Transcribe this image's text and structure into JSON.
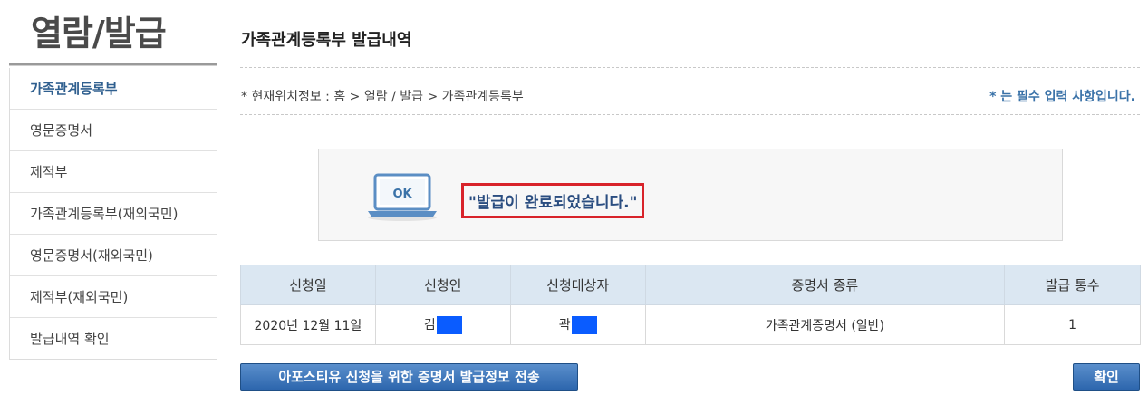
{
  "sidebar": {
    "title": "열람/발급",
    "items": [
      {
        "label": "가족관계등록부",
        "active": true
      },
      {
        "label": "영문증명서",
        "active": false
      },
      {
        "label": "제적부",
        "active": false
      },
      {
        "label": "가족관계등록부(재외국민)",
        "active": false
      },
      {
        "label": "영문증명서(재외국민)",
        "active": false
      },
      {
        "label": "제적부(재외국민)",
        "active": false
      },
      {
        "label": "발급내역 확인",
        "active": false
      }
    ]
  },
  "main": {
    "title": "가족관계등록부 발급내역",
    "breadcrumb": "* 현재위치정보 : 홈 > 열람 / 발급 > 가족관계등록부",
    "required_note": "* 는 필수 입력 사항입니다.",
    "notice": {
      "icon_label": "OK",
      "message": "\"발급이 완료되었습니다.\""
    },
    "table": {
      "headers": [
        "신청일",
        "신청인",
        "신청대상자",
        "증명서 종류",
        "발급 통수"
      ],
      "row": {
        "date": "2020년 12월 11일",
        "applicant": "김",
        "target": "곽",
        "cert_type": "가족관계증명서 (일반)",
        "count": "1"
      }
    },
    "buttons": {
      "send": "아포스티유 신청을 위한 증명서 발급정보 전송",
      "confirm": "확인"
    }
  },
  "colors": {
    "accent": "#2f5f8f",
    "header_bg": "#dbe7f2",
    "highlight_border": "#d8232a",
    "mask": "#0a5cff"
  }
}
